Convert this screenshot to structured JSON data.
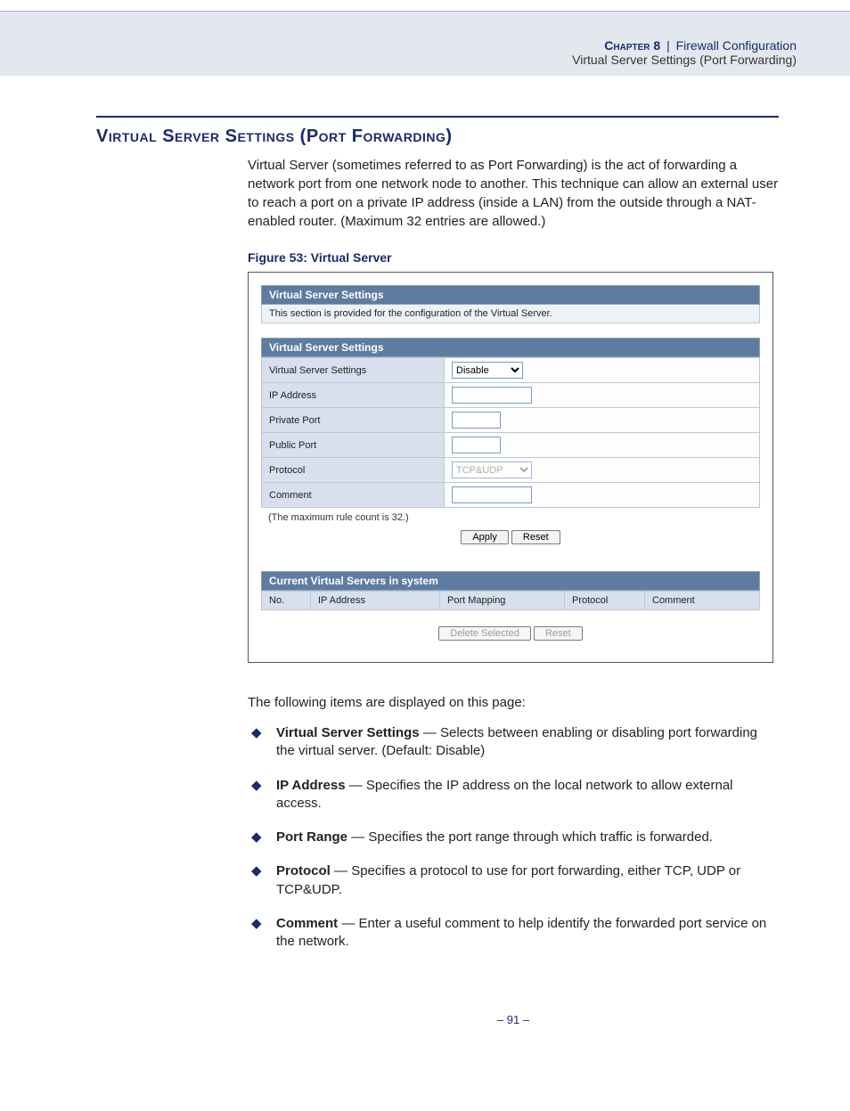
{
  "header": {
    "chapter_label": "Chapter 8",
    "sep": "|",
    "chapter_title": "Firewall Configuration",
    "subtitle": "Virtual Server Settings (Port Forwarding)"
  },
  "section": {
    "title": "Virtual Server Settings (Port Forwarding)",
    "intro": "Virtual Server (sometimes referred to as Port Forwarding) is the act of forwarding a network port from one network node to another. This technique can allow an external user to reach a port on a private IP address (inside a LAN) from the outside through a NAT-enabled router. (Maximum 32 entries are allowed.)"
  },
  "figure": {
    "caption": "Figure 53:  Virtual Server",
    "panel1_title": "Virtual Server Settings",
    "panel1_desc": "This section is provided for the configuration of the Virtual Server.",
    "panel2_title": "Virtual Server Settings",
    "fields": {
      "vs_settings_label": "Virtual Server Settings",
      "vs_settings_value": "Disable",
      "ip_label": "IP Address",
      "ip_value": "",
      "private_port_label": "Private Port",
      "private_port_value": "",
      "public_port_label": "Public Port",
      "public_port_value": "",
      "protocol_label": "Protocol",
      "protocol_value": "TCP&UDP",
      "comment_label": "Comment",
      "comment_value": ""
    },
    "note": "(The maximum rule count is 32.)",
    "apply": "Apply",
    "reset": "Reset",
    "list_title": "Current Virtual Servers in system",
    "list_cols": {
      "no": "No.",
      "ip": "IP Address",
      "port": "Port Mapping",
      "proto": "Protocol",
      "comment": "Comment"
    },
    "delete_selected": "Delete Selected",
    "reset2": "Reset"
  },
  "items_lead": "The following items are displayed on this page:",
  "items": [
    {
      "term": "Virtual Server Settings",
      "desc": "Selects between enabling or disabling port forwarding the virtual server. (Default: Disable)"
    },
    {
      "term": "IP Address",
      "desc": "Specifies the IP address on the local network to allow external access."
    },
    {
      "term": "Port Range",
      "desc": "Specifies the port range through which traffic is forwarded."
    },
    {
      "term": "Protocol",
      "desc": "Specifies a protocol to use for port forwarding, either TCP, UDP or TCP&UDP."
    },
    {
      "term": "Comment",
      "desc": "Enter a useful comment to help identify the forwarded port service on the network."
    }
  ],
  "footer": {
    "page_before": "–  ",
    "page": "91",
    "page_after": "  –"
  }
}
